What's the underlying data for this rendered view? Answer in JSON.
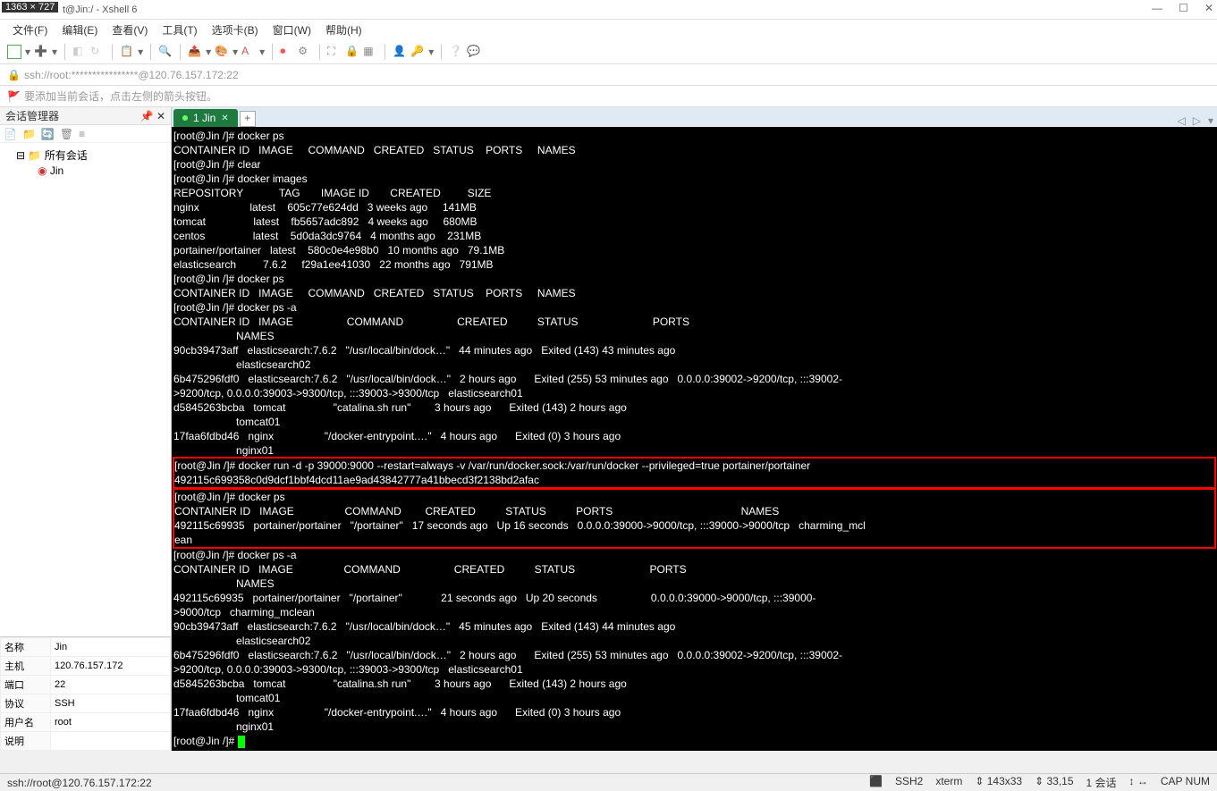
{
  "title_dim": "1363 × 727",
  "title": "t@Jin:/ - Xshell 6",
  "menus": [
    "文件(F)",
    "编辑(E)",
    "查看(V)",
    "工具(T)",
    "选项卡(B)",
    "窗口(W)",
    "帮助(H)"
  ],
  "addr": "ssh://root:****************@120.76.157.172:22",
  "quick": "要添加当前会话，点击左侧的箭头按钮。",
  "panel_title": "会话管理器",
  "tree_root": "所有会话",
  "tree_child": "Jin",
  "props": [
    [
      "名称",
      "Jin"
    ],
    [
      "主机",
      "120.76.157.172"
    ],
    [
      "端口",
      "22"
    ],
    [
      "协议",
      "SSH"
    ],
    [
      "用户名",
      "root"
    ],
    [
      "说明",
      ""
    ]
  ],
  "tab_label": "1 Jin",
  "lines": [
    "[root@Jin /]# docker ps",
    "CONTAINER ID   IMAGE     COMMAND   CREATED   STATUS    PORTS     NAMES",
    "[root@Jin /]# clear",
    "[root@Jin /]# docker images",
    "REPOSITORY            TAG       IMAGE ID       CREATED         SIZE",
    "nginx                 latest    605c77e624dd   3 weeks ago     141MB",
    "tomcat                latest    fb5657adc892   4 weeks ago     680MB",
    "centos                latest    5d0da3dc9764   4 months ago    231MB",
    "portainer/portainer   latest    580c0e4e98b0   10 months ago   79.1MB",
    "elasticsearch         7.6.2     f29a1ee41030   22 months ago   791MB",
    "[root@Jin /]# docker ps",
    "CONTAINER ID   IMAGE     COMMAND   CREATED   STATUS    PORTS     NAMES",
    "[root@Jin /]# docker ps -a",
    "CONTAINER ID   IMAGE                  COMMAND                  CREATED          STATUS                         PORTS",
    "                     NAMES",
    "90cb39473aff   elasticsearch:7.6.2   \"/usr/local/bin/dock…\"   44 minutes ago   Exited (143) 43 minutes ago",
    "                     elasticsearch02",
    "6b475296fdf0   elasticsearch:7.6.2   \"/usr/local/bin/dock…\"   2 hours ago      Exited (255) 53 minutes ago   0.0.0.0:39002->9200/tcp, :::39002-",
    ">9200/tcp, 0.0.0.0:39003->9300/tcp, :::39003->9300/tcp   elasticsearch01",
    "d5845263bcba   tomcat                \"catalina.sh run\"        3 hours ago      Exited (143) 2 hours ago",
    "                     tomcat01",
    "17faa6fdbd46   nginx                 \"/docker-entrypoint.…\"   4 hours ago      Exited (0) 3 hours ago",
    "                     nginx01"
  ],
  "hl1": [
    "[root@Jin /]# docker run -d -p 39000:9000 --restart=always -v /var/run/docker.sock:/var/run/docker --privileged=true portainer/portainer",
    "492115c699358c0d9dcf1bbf4dcd11ae9ad43842777a41bbecd3f2138bd2afac"
  ],
  "hl2": [
    "[root@Jin /]# docker ps",
    "CONTAINER ID   IMAGE                 COMMAND        CREATED          STATUS          PORTS                                           NAMES",
    "492115c69935   portainer/portainer   \"/portainer\"   17 seconds ago   Up 16 seconds   0.0.0.0:39000->9000/tcp, :::39000->9000/tcp   charming_mcl",
    "ean"
  ],
  "lines2": [
    "[root@Jin /]# docker ps -a",
    "CONTAINER ID   IMAGE                 COMMAND                  CREATED          STATUS                         PORTS",
    "                     NAMES",
    "492115c69935   portainer/portainer   \"/portainer\"             21 seconds ago   Up 20 seconds                  0.0.0.0:39000->9000/tcp, :::39000-",
    ">9000/tcp   charming_mclean",
    "90cb39473aff   elasticsearch:7.6.2   \"/usr/local/bin/dock…\"   45 minutes ago   Exited (143) 44 minutes ago",
    "                     elasticsearch02",
    "6b475296fdf0   elasticsearch:7.6.2   \"/usr/local/bin/dock…\"   2 hours ago      Exited (255) 53 minutes ago   0.0.0.0:39002->9200/tcp, :::39002-",
    ">9200/tcp, 0.0.0.0:39003->9300/tcp, :::39003->9300/tcp   elasticsearch01",
    "d5845263bcba   tomcat                \"catalina.sh run\"        3 hours ago      Exited (143) 2 hours ago",
    "                     tomcat01",
    "17faa6fdbd46   nginx                 \"/docker-entrypoint.…\"   4 hours ago      Exited (0) 3 hours ago",
    "                     nginx01",
    "[root@Jin /]# "
  ],
  "status_left": "ssh://root@120.76.157.172:22",
  "status_r": [
    "SSH2",
    "xterm",
    "⇕ 143x33",
    "⇕ 33,15",
    "1 会话",
    "↕ ↔",
    "CAP  NUM"
  ],
  "grn_icon": "⬛"
}
